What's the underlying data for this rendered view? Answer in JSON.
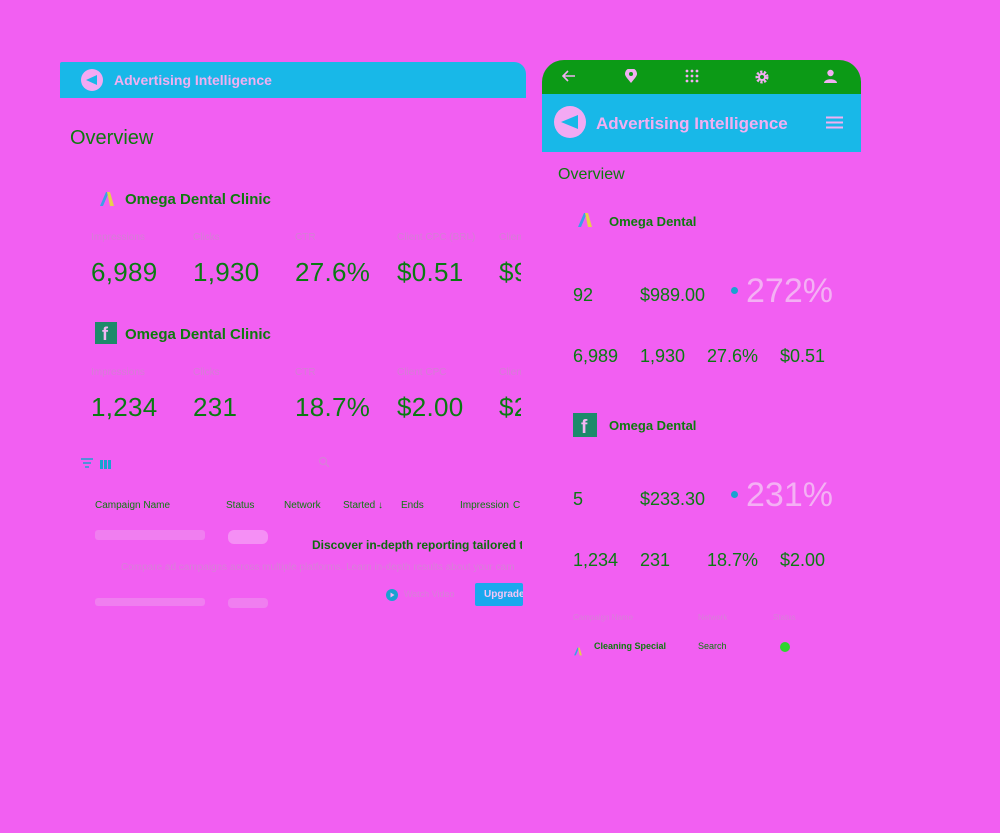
{
  "desktop": {
    "app_title": "Advertising Intelligence",
    "overview_label": "Overview",
    "google_block": {
      "client": "Omega Dental Clinic",
      "metrics": [
        {
          "label": "Impressions",
          "value": "6,989"
        },
        {
          "label": "Clicks",
          "value": "1,930"
        },
        {
          "label": "CTR",
          "value": "27.6%"
        },
        {
          "label": "Client CPC (BRL)",
          "value": "$0.51"
        },
        {
          "label": "Clien",
          "value": "$9"
        }
      ]
    },
    "facebook_block": {
      "client": "Omega Dental Clinic",
      "metrics": [
        {
          "label": "Impressions",
          "value": "1,234"
        },
        {
          "label": "Clicks",
          "value": "231"
        },
        {
          "label": "CTR",
          "value": "18.7%"
        },
        {
          "label": "Client CPC",
          "value": "$2.00"
        },
        {
          "label": "Clien",
          "value": "$2"
        }
      ]
    },
    "table_headers": [
      "Campaign Name",
      "Status",
      "Network",
      "Started ↓",
      "Ends",
      "Impression",
      "C"
    ],
    "upsell": {
      "headline": "Discover in-depth reporting tailored t",
      "body": "Compare ad campaigns across multiple platforms. Learn in-depth results about your cam",
      "watch_video_label": "Watch Video",
      "upgrade_label": "Upgrade"
    }
  },
  "mobile": {
    "app_title": "Advertising Intelligence",
    "overview_label": "Overview",
    "google_block": {
      "client": "Omega Dental",
      "row1": [
        "92",
        "$989.00"
      ],
      "big_percent": "272%",
      "row2": [
        "6,989",
        "1,930",
        "27.6%",
        "$0.51"
      ]
    },
    "facebook_block": {
      "client": "Omega Dental",
      "row1": [
        "5",
        "$233.30"
      ],
      "big_percent": "231%",
      "row2": [
        "1,234",
        "231",
        "18.7%",
        "$2.00"
      ]
    },
    "table_headers": [
      "Campaign Name",
      "Network",
      "Status"
    ],
    "rows": [
      {
        "name": "Cleaning Special",
        "network": "Search",
        "status_color": "#2fd42f"
      }
    ]
  },
  "colors": {
    "background": "#f25ff2",
    "header_cyan": "#18b8e8",
    "mobile_top_green": "#0c9a16",
    "text_green": "#0a7a12",
    "upgrade_blue": "#1aa8ee"
  }
}
